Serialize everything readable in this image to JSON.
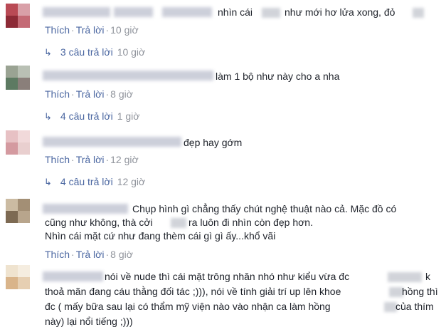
{
  "comments": [
    {
      "lines": [
        "nhìn cái",
        "như mới hơ lửa xong, đỏ"
      ],
      "like": "Thích",
      "reply": "Trả lời",
      "time": "10 giờ",
      "replies": {
        "count": "3 câu trả lời",
        "time": "10 giờ"
      }
    },
    {
      "lines": [
        "làm 1 bộ như này cho a nha"
      ],
      "like": "Thích",
      "reply": "Trả lời",
      "time": "8 giờ",
      "replies": {
        "count": "4 câu trả lời",
        "time": "1 giờ"
      }
    },
    {
      "lines": [
        "đẹp hay gớm"
      ],
      "like": "Thích",
      "reply": "Trả lời",
      "time": "12 giờ",
      "replies": {
        "count": "4 câu trả lời",
        "time": "12 giờ"
      }
    },
    {
      "lines": [
        "Chụp hình gì chẳng thấy chút nghệ thuật nào cả. Mặc đồ có",
        "cũng như không, thà cởi",
        "ra luôn đi nhìn còn đẹp hơn.",
        "Nhìn cái mặt cứ như đang thèm cái gì gì ấy...khổ vãi"
      ],
      "like": "Thích",
      "reply": "Trả lời",
      "time": "8 giờ"
    },
    {
      "lines": [
        "nói về nude thì cái mặt trông nhăn nhó như kiểu vừa đc",
        "k",
        "thoả mãn đang cáu thằng đối tác ;))), nói về tính giải trí up lên khoe",
        "hồng thì",
        "đc ( mấy bữa sau lại có thẩm mỹ viện nào vào nhận ca làm hồng",
        "của thím",
        "này) lại nổi tiếng ;)))"
      ]
    }
  ],
  "colors": {
    "link": "#4b67a1",
    "meta": "#90949c",
    "text": "#1d2129"
  }
}
